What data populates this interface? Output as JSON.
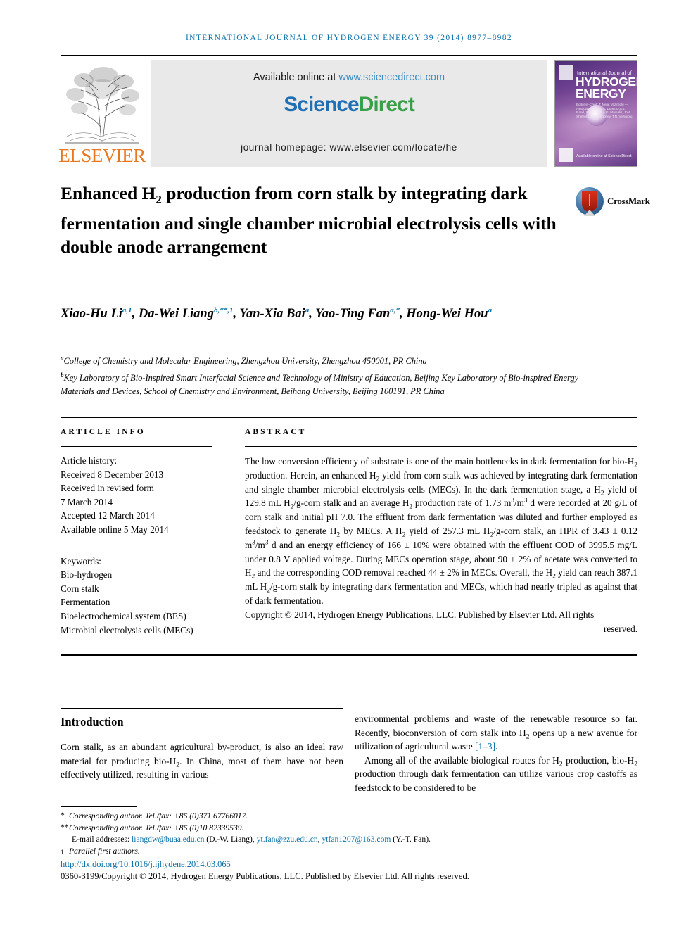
{
  "running_head": "International Journal of Hydrogen Energy 39 (2014) 8977–8982",
  "masthead": {
    "elsevier_wordmark": "ELSEVIER",
    "available_prefix": "Available online at ",
    "available_url": "www.sciencedirect.com",
    "sciencedirect_part1": "Science",
    "sciencedirect_part2": "Direct",
    "homepage": "journal homepage: www.elsevier.com/locate/he",
    "cover": {
      "small_title": "International Journal of",
      "big_title_line1": "HYDROGEN",
      "big_title_line2": "ENERGY",
      "editors": "Editor-in-Chief: T. Nejat Veziroglu — Associate Editors: S. Dunn, D.A.J. Rand, S.A. Sherif, A.G. Mamalis, J.W. Sheffield, S.A. Grigoriev, T.N. Veziroglu",
      "sciencedirect_credit": "Available online at ScienceDirect"
    },
    "accent_blue": "#3a8cc1",
    "sd_green": "#37a048",
    "sd_blue": "#1f6fb5",
    "elsevier_orange": "#e87722",
    "runhead_blue": "#0a71a8"
  },
  "crossmark": {
    "label": "CrossMark"
  },
  "title": {
    "line1_a": "Enhanced H",
    "line1_sub": "2",
    "line1_b": " production from corn stalk by",
    "line2": "integrating dark fermentation and single chamber",
    "line3": "microbial electrolysis cells with double anode",
    "line4": "arrangement"
  },
  "authors": [
    {
      "name": "Xiao-Hu Li",
      "marks": "a,1",
      "sep": ", "
    },
    {
      "name": "Da-Wei Liang",
      "marks": "b,**,1",
      "sep": ", "
    },
    {
      "name": "Yan-Xia Bai",
      "marks": "a",
      "sep": ", "
    },
    {
      "name": "Yao-Ting Fan",
      "marks": "a,*",
      "sep": ", "
    },
    {
      "name": "Hong-Wei Hou",
      "marks": "a",
      "sep": ""
    }
  ],
  "affiliations": [
    {
      "mark": "a",
      "text": "College of Chemistry and Molecular Engineering, Zhengzhou University, Zhengzhou 450001, PR China"
    },
    {
      "mark": "b",
      "text": "Key Laboratory of Bio-Inspired Smart Interfacial Science and Technology of Ministry of Education, Beijing Key Laboratory of Bio-inspired Energy Materials and Devices, School of Chemistry and Environment, Beihang University, Beijing 100191, PR China"
    }
  ],
  "article_info": {
    "heading": "ARTICLE INFO",
    "history_label": "Article history:",
    "history": [
      "Received 8 December 2013",
      "Received in revised form",
      "7 March 2014",
      "Accepted 12 March 2014",
      "Available online 5 May 2014"
    ],
    "keywords_label": "Keywords:",
    "keywords": [
      "Bio-hydrogen",
      "Corn stalk",
      "Fermentation",
      "Bioelectrochemical system (BES)",
      "Microbial electrolysis cells (MECs)"
    ]
  },
  "abstract": {
    "heading": "ABSTRACT",
    "text": "The low conversion efficiency of substrate is one of the main bottlenecks in dark fermentation for bio-H2 production. Herein, an enhanced H2 yield from corn stalk was achieved by integrating dark fermentation and single chamber microbial electrolysis cells (MECs). In the dark fermentation stage, a H2 yield of 129.8 mL H2/g-corn stalk and an average H2 production rate of 1.73 m3/m3 d were recorded at 20 g/L of corn stalk and initial pH 7.0. The effluent from dark fermentation was diluted and further employed as feedstock to generate H2 by MECs. A H2 yield of 257.3 mL H2/g-corn stalk, an HPR of 3.43 ± 0.12 m3/m3 d and an energy efficiency of 166 ± 10% were obtained with the effluent COD of 3995.5 mg/L under 0.8 V applied voltage. During MECs operation stage, about 90 ± 2% of acetate was converted to H2 and the corresponding COD removal reached 44 ± 2% in MECs. Overall, the H2 yield can reach 387.1 mL H2/g-corn stalk by integrating dark fermentation and MECs, which had nearly tripled as against that of dark fermentation.",
    "copyright_main": "Copyright © 2014, Hydrogen Energy Publications, LLC. Published by Elsevier Ltd. All rights",
    "copyright_tail": "reserved."
  },
  "body": {
    "section_title": "Introduction",
    "left_paragraph": "Corn stalk, as an abundant agricultural by-product, is also an ideal raw material for producing bio-H2. In China, most of them have not been effectively utilized, resulting in various",
    "right_paragraph_1_a": "environmental problems and waste of the renewable resource so far. Recently, bioconversion of corn stalk into H2 opens up a new avenue for utilization of agricultural waste ",
    "right_paragraph_1_ref": "[1–3]",
    "right_paragraph_1_b": ".",
    "right_paragraph_2": "Among all of the available biological routes for H2 production, bio-H2 production through dark fermentation can utilize various crop castoffs as feedstock to be considered to be"
  },
  "footnotes": {
    "corresponding_1_mark": "*",
    "corresponding_1": "Corresponding author. Tel./fax: +86 (0)371 67766017.",
    "corresponding_2_mark": "**",
    "corresponding_2": "Corresponding author. Tel./fax: +86 (0)10 82339539.",
    "email_label": "E-mail addresses: ",
    "email_1": "liangdw@buaa.edu.cn",
    "email_1_owner": " (D.-W. Liang), ",
    "email_2": "yt.fan@zzu.edu.cn",
    "email_2_sep": ", ",
    "email_3": "ytfan1207@163.com",
    "email_3_owner": " (Y.-T. Fan).",
    "parallel_mark": "1",
    "parallel_note": "Parallel first authors.",
    "doi": "http://dx.doi.org/10.1016/j.ijhydene.2014.03.065",
    "issn_copyright": "0360-3199/Copyright © 2014, Hydrogen Energy Publications, LLC. Published by Elsevier Ltd. All rights reserved."
  }
}
